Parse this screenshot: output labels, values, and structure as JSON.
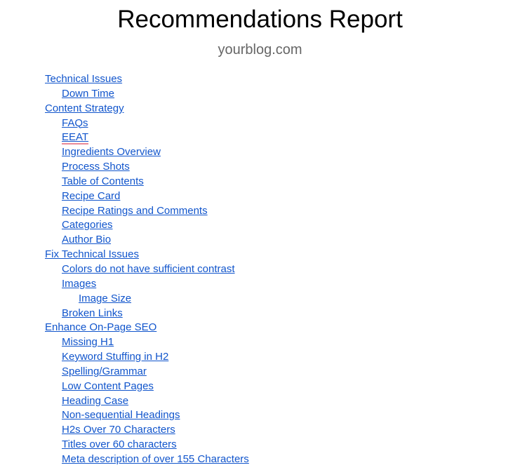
{
  "document": {
    "title": "Recommendations Report",
    "subtitle": "yourblog.com",
    "link_color": "#1155cc",
    "spellcheck_color": "#ea8a97"
  },
  "toc": [
    {
      "label": "Technical Issues",
      "level": 1
    },
    {
      "label": "Down Time",
      "level": 2
    },
    {
      "label": "Content Strategy",
      "level": 1
    },
    {
      "label": "FAQs",
      "level": 2
    },
    {
      "label": "EEAT",
      "level": 2,
      "spellcheck_flag": true
    },
    {
      "label": "Ingredients Overview",
      "level": 2
    },
    {
      "label": "Process Shots",
      "level": 2
    },
    {
      "label": "Table of Contents",
      "level": 2
    },
    {
      "label": "Recipe Card",
      "level": 2
    },
    {
      "label": "Recipe Ratings and Comments",
      "level": 2
    },
    {
      "label": "Categories",
      "level": 2
    },
    {
      "label": "Author Bio",
      "level": 2
    },
    {
      "label": "Fix Technical Issues",
      "level": 1
    },
    {
      "label": "Colors do not have sufficient contrast",
      "level": 2
    },
    {
      "label": "Images",
      "level": 2
    },
    {
      "label": "Image Size",
      "level": 3
    },
    {
      "label": "Broken Links",
      "level": 2
    },
    {
      "label": "Enhance On-Page SEO",
      "level": 1
    },
    {
      "label": "Missing H1",
      "level": 2
    },
    {
      "label": "Keyword Stuffing in H2",
      "level": 2
    },
    {
      "label": "Spelling/Grammar",
      "level": 2
    },
    {
      "label": "Low Content Pages",
      "level": 2
    },
    {
      "label": "Heading Case",
      "level": 2
    },
    {
      "label": "Non-sequential Headings",
      "level": 2
    },
    {
      "label": "H2s Over 70 Characters",
      "level": 2
    },
    {
      "label": "Titles over 60 characters",
      "level": 2
    },
    {
      "label": "Meta description of over 155 Characters",
      "level": 2
    }
  ]
}
